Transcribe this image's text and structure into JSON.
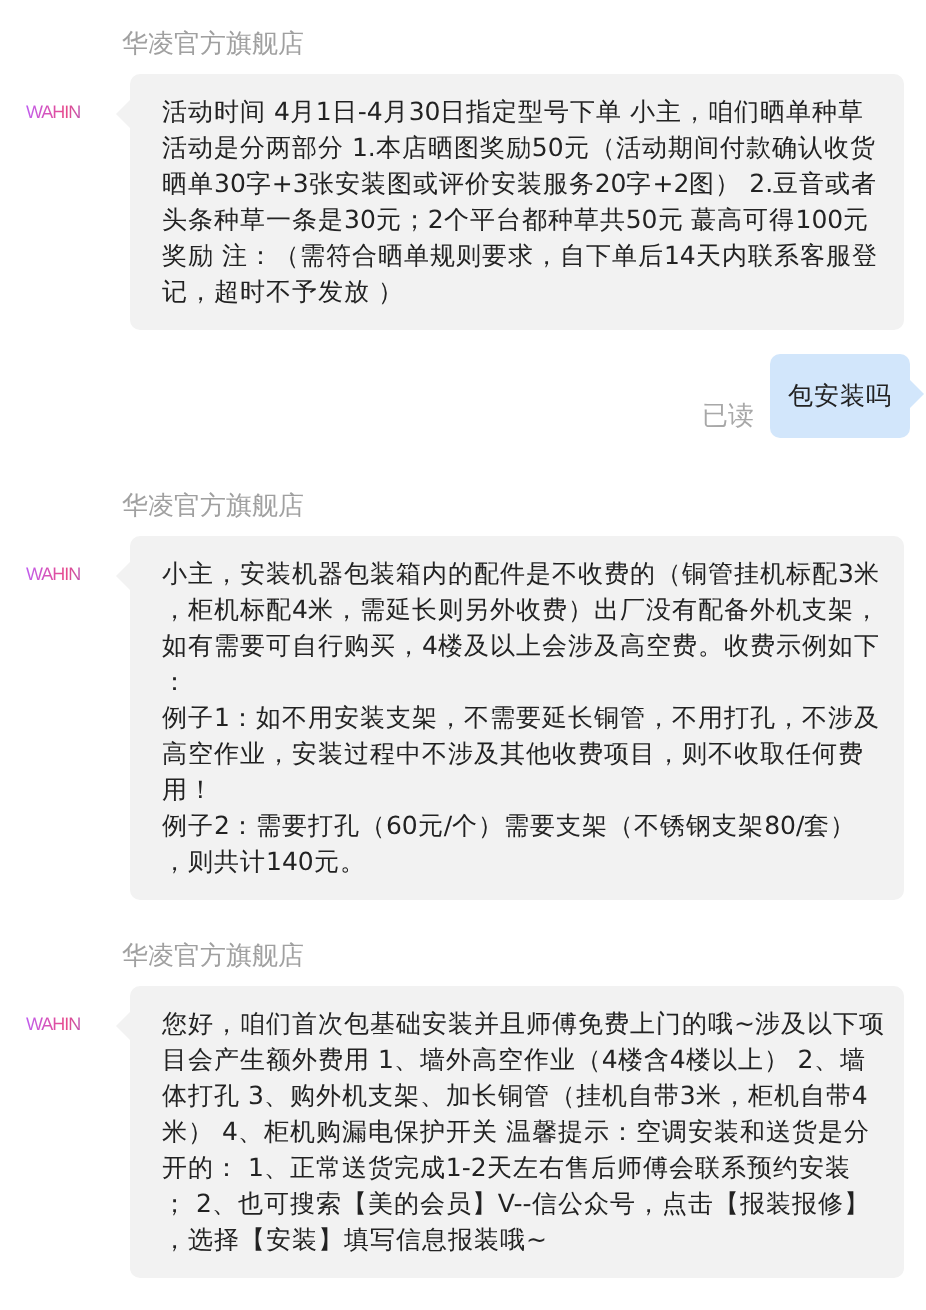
{
  "messages": [
    {
      "kind": "incoming",
      "sender": "华凌官方旗舰店",
      "avatar_logo": "WAHIN",
      "lines": [
        "活动时间 4月1日-4月30日指定型号下单 小主，咱们晒单种草",
        "活动是分两部分 1.本店晒图奖励50元（活动期间付款确认收货",
        "晒单30字+3张安装图或评价安装服务20字+2图） 2.豆音或者",
        "头条种草一条是30元；2个平台都种草共50元 蕞高可得100元",
        "奖励 注：（需符合晒单规则要求，自下单后14天内联系客服登",
        "记，超时不予发放 ）"
      ]
    },
    {
      "kind": "outgoing",
      "status": "已读",
      "lines": [
        "包安装吗"
      ]
    },
    {
      "kind": "incoming",
      "sender": "华凌官方旗舰店",
      "avatar_logo": "WAHIN",
      "lines": [
        "小主，安装机器包装箱内的配件是不收费的（铜管挂机标配3米",
        "，柜机标配4米，需延长则另外收费）出厂没有配备外机支架，",
        "如有需要可自行购买，4楼及以上会涉及高空费。收费示例如下",
        "：",
        "例子1：如不用安装支架，不需要延长铜管，不用打孔，不涉及",
        "高空作业，安装过程中不涉及其他收费项目，则不收取任何费",
        "用！",
        "例子2：需要打孔（60元/个）需要支架（不锈钢支架80/套）",
        "，则共计140元。"
      ]
    },
    {
      "kind": "incoming",
      "sender": "华凌官方旗舰店",
      "avatar_logo": "WAHIN",
      "lines": [
        "您好，咱们首次包基础安装并且师傅免费上门的哦~涉及以下项",
        "目会产生额外费用 1、墙外高空作业（4楼含4楼以上） 2、墙",
        "体打孔 3、购外机支架、加长铜管（挂机自带3米，柜机自带4",
        "米） 4、柜机购漏电保护开关 温馨提示：空调安装和送货是分",
        "开的： 1、正常送货完成1-2天左右售后师傅会联系预约安装",
        "； 2、也可搜索【美的会员】V--信公众号，点击【报装报修】",
        "，选择【安装】填写信息报装哦~"
      ]
    }
  ]
}
